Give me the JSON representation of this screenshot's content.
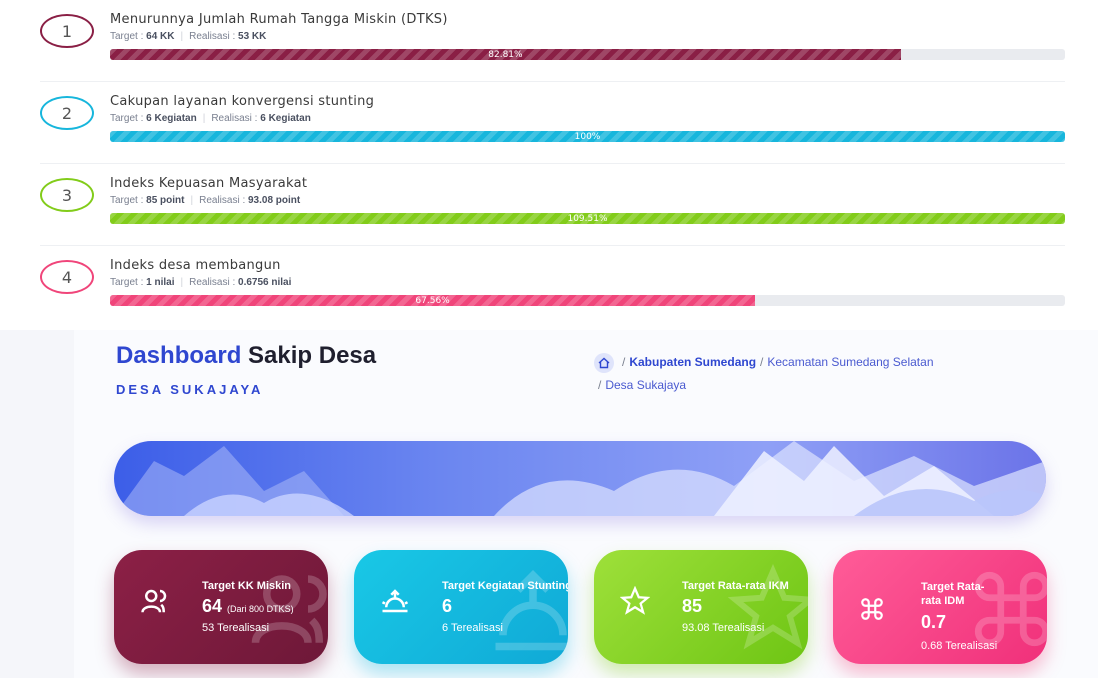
{
  "indicators": [
    {
      "num": "1",
      "title": "Menurunnya Jumlah Rumah Tangga Miskin (DTKS)",
      "target_label": "Target : ",
      "target": "64 KK",
      "real_label": "Realisasi : ",
      "real": "53 KK",
      "pct": "82.81%",
      "fill": 0.8281,
      "color": "#8a1f45",
      "ring": "#8a1f45"
    },
    {
      "num": "2",
      "title": "Cakupan layanan konvergensi stunting",
      "target_label": "Target : ",
      "target": "6 Kegiatan",
      "real_label": "Realisasi : ",
      "real": "6 Kegiatan",
      "pct": "100%",
      "fill": 1.0,
      "color": "#17b6dc",
      "ring": "#17b6dc"
    },
    {
      "num": "3",
      "title": "Indeks Kepuasan Masyarakat",
      "target_label": "Target : ",
      "target": "85 point",
      "real_label": "Realisasi : ",
      "real": "93.08 point",
      "pct": "109.51%",
      "fill": 1.0,
      "color": "#82cc1a",
      "ring": "#82cc1a"
    },
    {
      "num": "4",
      "title": "Indeks desa membangun",
      "target_label": "Target : ",
      "target": "1 nilai",
      "real_label": "Realisasi : ",
      "real": "0.6756 nilai",
      "pct": "67.56%",
      "fill": 0.6756,
      "color": "#f0457a",
      "ring": "#f0457a"
    }
  ],
  "dashboard": {
    "title_a": "Dashboard",
    "title_b": "Sakip Desa",
    "subtitle": "DESA SUKAJAYA"
  },
  "breadcrumb": {
    "kabupaten": "Kabupaten Sumedang",
    "kecamatan": "Kecamatan Sumedang Selatan",
    "desa": "Desa Sukajaya"
  },
  "cards": [
    {
      "title": "Target KK Miskin",
      "value": "64",
      "extra": "(Dari 800 DTKS)",
      "realized": "53 Terealisasi",
      "icon": "users-icon"
    },
    {
      "title": "Target Kegiatan Stunting",
      "value": "6",
      "extra": "",
      "realized": "6 Terealisasi",
      "icon": "sunrise-icon"
    },
    {
      "title": "Target Rata-rata IKM",
      "value": "85",
      "extra": "",
      "realized": "93.08 Terealisasi",
      "icon": "star-icon"
    },
    {
      "title": "Target Rata-rata IDM",
      "value": "0.7",
      "extra": "",
      "realized": "0.68 Terealisasi",
      "icon": "command-icon"
    }
  ]
}
